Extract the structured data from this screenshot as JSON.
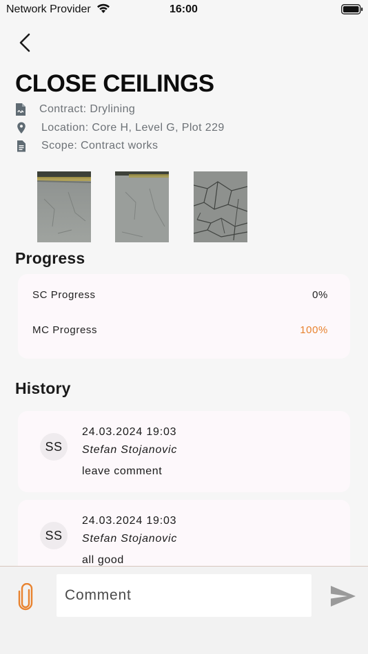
{
  "status_bar": {
    "carrier": "Network Provider",
    "time": "16:00"
  },
  "task": {
    "title": "CLOSE CEILINGS",
    "contract": "Contract: Drylining",
    "location": "Location: Core H, Level G, Plot 229",
    "scope": "Scope: Contract works"
  },
  "photos_count": 3,
  "progress": {
    "heading": "Progress",
    "rows": [
      {
        "label": "SC Progress",
        "value": "0%",
        "color": "#222222"
      },
      {
        "label": "MC Progress",
        "value": "100%",
        "color": "#e8822e"
      }
    ]
  },
  "history": {
    "heading": "History",
    "entries": [
      {
        "initials": "SS",
        "date": "24.03.2024 19:03",
        "author": "Stefan Stojanovic",
        "comment": "leave comment"
      },
      {
        "initials": "SS",
        "date": "24.03.2024 19:03",
        "author": "Stefan Stojanovic",
        "comment": "all good"
      }
    ]
  },
  "composer": {
    "placeholder": "Comment"
  },
  "colors": {
    "accent": "#e8822e",
    "card_bg": "#fdf8fb",
    "muted_text": "#6c7176"
  },
  "icons": [
    "back-arrow-icon",
    "contract-icon",
    "location-pin-icon",
    "document-icon",
    "attach-icon",
    "send-icon",
    "wifi-icon",
    "battery-icon"
  ]
}
